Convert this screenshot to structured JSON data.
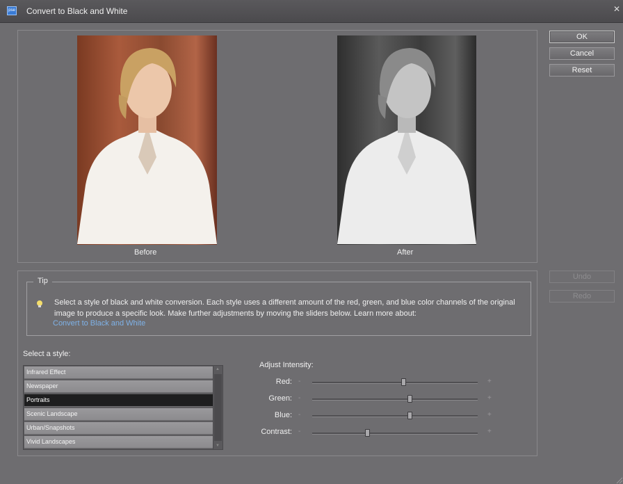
{
  "window": {
    "title": "Convert to Black and White",
    "icon": "photoshop-elements-icon"
  },
  "preview": {
    "before_label": "Before",
    "after_label": "After"
  },
  "buttons": {
    "ok": "OK",
    "cancel": "Cancel",
    "reset": "Reset",
    "undo": "Undo",
    "redo": "Redo"
  },
  "tip": {
    "legend": "Tip",
    "text": "Select a style of black and white conversion. Each style uses a different amount of the red, green, and blue color channels of the original image to produce a specific look. Make further adjustments by moving the sliders below. Learn more about:",
    "link": "Convert to Black and White"
  },
  "styles": {
    "label": "Select a style:",
    "items": [
      "Infrared Effect",
      "Newspaper",
      "Portraits",
      "Scenic Landscape",
      "Urban/Snapshots",
      "Vivid Landscapes"
    ],
    "selected": "Portraits"
  },
  "adjust": {
    "label": "Adjust Intensity:",
    "minus": "-",
    "plus": "+",
    "sliders": [
      {
        "label": "Red:",
        "value": 0.55
      },
      {
        "label": "Green:",
        "value": 0.59
      },
      {
        "label": "Blue:",
        "value": 0.59
      },
      {
        "label": "Contrast:",
        "value": 0.33
      }
    ]
  },
  "colors": {
    "background": "#6e6d70",
    "link": "#7fb2e8",
    "selected_row": "#1e1e1f"
  }
}
